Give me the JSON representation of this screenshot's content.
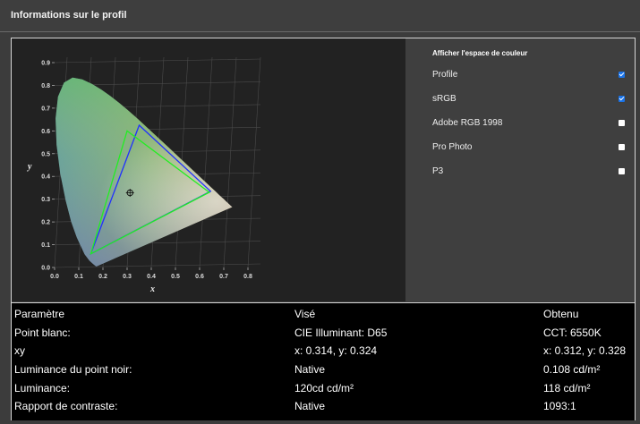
{
  "header": {
    "title": "Informations sur le profil"
  },
  "chart_data": {
    "type": "scatter",
    "xlabel": "x",
    "ylabel": "y",
    "xlim": [
      0.0,
      0.8
    ],
    "ylim": [
      0.0,
      0.9
    ],
    "x_ticks": [
      "0.0",
      "0.1",
      "0.2",
      "0.3",
      "0.4",
      "0.5",
      "0.6",
      "0.7",
      "0.8"
    ],
    "y_ticks": [
      "0.0",
      "0.1",
      "0.2",
      "0.3",
      "0.4",
      "0.5",
      "0.6",
      "0.7",
      "0.8",
      "0.9"
    ],
    "grid": true,
    "series": [
      {
        "color": "#2030ff",
        "points": [
          [
            0.35,
            0.625
          ],
          [
            0.645,
            0.335
          ],
          [
            0.15,
            0.06
          ]
        ]
      },
      {
        "color": "#22ee22",
        "points": [
          [
            0.64,
            0.33
          ],
          [
            0.3,
            0.6
          ],
          [
            0.15,
            0.06
          ]
        ]
      }
    ],
    "white_point": [
      0.312,
      0.328
    ]
  },
  "color_space": {
    "title": "Afficher l'espace de couleur",
    "options": [
      {
        "label": "Profile",
        "checked": true
      },
      {
        "label": "sRGB",
        "checked": true
      },
      {
        "label": "Adobe RGB 1998",
        "checked": false
      },
      {
        "label": "Pro Photo",
        "checked": false
      },
      {
        "label": "P3",
        "checked": false
      }
    ]
  },
  "table": {
    "headers": [
      "Paramètre",
      "Visé",
      "Obtenu"
    ],
    "rows": [
      [
        "Point blanc:",
        "CIE Illuminant: D65",
        "CCT: 6550K"
      ],
      [
        "xy",
        "x: 0.314, y: 0.324",
        "x: 0.312, y: 0.328"
      ],
      [
        "Luminance du point noir:",
        "Native",
        "0.108 cd/m²"
      ],
      [
        "Luminance:",
        "120cd cd/m²",
        "118 cd/m²"
      ],
      [
        "Rapport de contraste:",
        "Native",
        "1093:1"
      ]
    ]
  }
}
